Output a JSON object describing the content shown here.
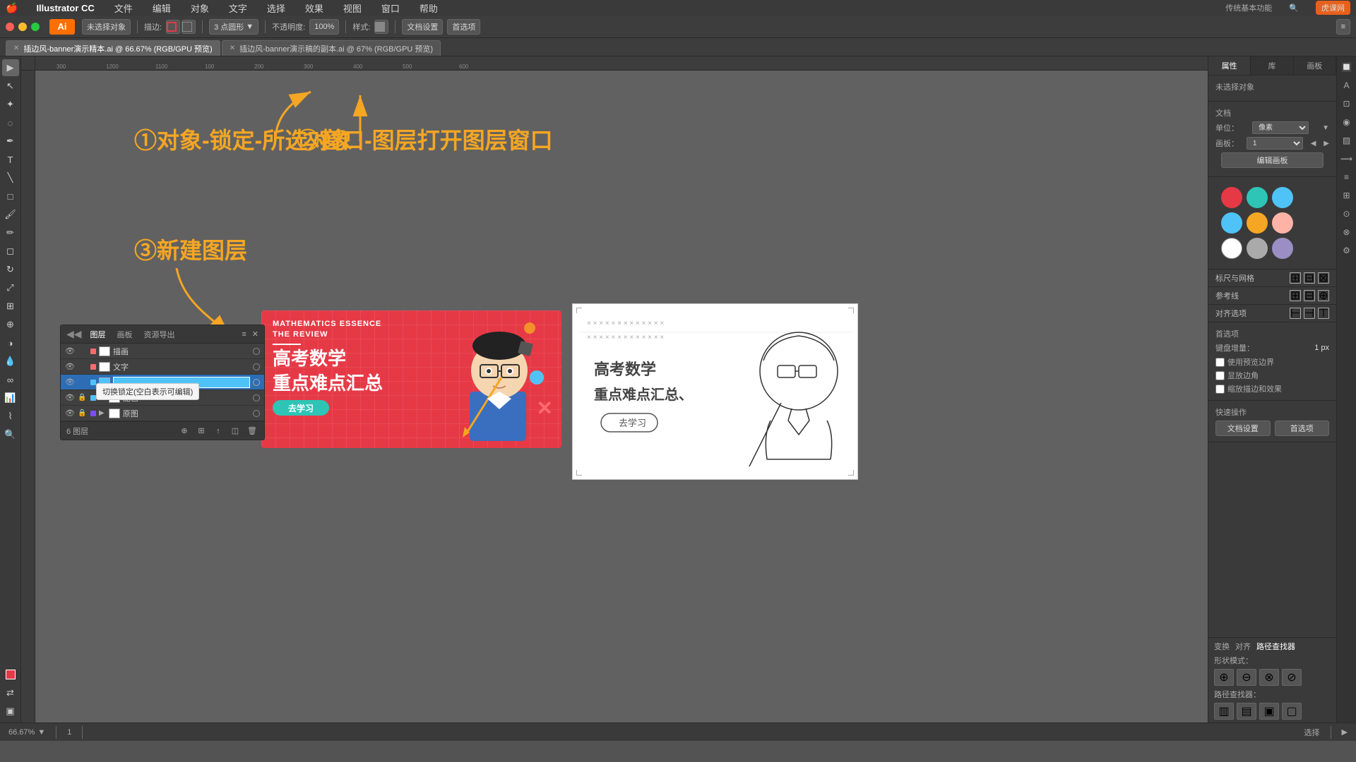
{
  "app": {
    "name": "Illustrator CC",
    "menu_items": [
      "文件",
      "编辑",
      "对象",
      "文字",
      "选择",
      "效果",
      "视图",
      "窗口",
      "帮助"
    ],
    "apple_menu": "🍎"
  },
  "toolbar": {
    "ai_label": "Ai",
    "tools": [
      "未选择对象"
    ],
    "desc_label": "描边:",
    "circle_label": "3 点圆形",
    "opacity_label": "不透明度:",
    "opacity_value": "100%",
    "style_label": "样式:",
    "doc_settings": "文档设置",
    "preferences": "首选项"
  },
  "tabs": [
    {
      "label": "插边风-banner演示精本.ai @ 66.67% (RGB/GPU 预览)",
      "active": true
    },
    {
      "label": "插边风-banner演示稿的副本.ai @ 67% (RGB/GPU 预览)",
      "active": false
    }
  ],
  "annotations": {
    "ann1": "①对象-锁定-所选对象",
    "ann2": "②窗口-图层打开图层窗口",
    "ann3": "③新建图层"
  },
  "math_banner": {
    "top_text_1": "MATHEMATICS ESSENCE",
    "top_text_2": "THE REVIEW",
    "main_text_1": "高考数学",
    "main_text_2": "重点难点汇总",
    "button_text": "去学习"
  },
  "sketch": {
    "text_1": "高考数学",
    "text_2": "重点难点汇总、",
    "button_text": "去学习"
  },
  "layers_panel": {
    "title": "图层",
    "tabs": [
      "图层",
      "画板",
      "资源导出"
    ],
    "layers": [
      {
        "name": "描画",
        "color": "#ff6b6b",
        "visible": true,
        "locked": false
      },
      {
        "name": "文字",
        "color": "#ff6b6b",
        "visible": true,
        "locked": false
      },
      {
        "name": "",
        "color": "#4fc3f7",
        "visible": true,
        "locked": false,
        "active": true,
        "editing": true
      },
      {
        "name": "配色",
        "color": "#4fc3f7",
        "visible": true,
        "locked": true,
        "has_sublayers": true
      },
      {
        "name": "原图",
        "color": "#7c4dff",
        "visible": true,
        "locked": true,
        "has_sublayers": true
      }
    ],
    "footer_text": "6 图层",
    "tooltip": "切换锁定(空白表示可编辑)"
  },
  "right_panel": {
    "tabs": [
      "属性",
      "库",
      "画板"
    ],
    "section_title": "未选择对象",
    "doc_section": "文档",
    "unit_label": "单位：",
    "unit_value": "像素",
    "artboard_label": "画板：",
    "artboard_value": "1",
    "edit_artboard_btn": "编辑画板",
    "align_section": "标尺与网格",
    "ref_section": "参考线",
    "align_to_section": "对齐选项",
    "snap_section": "首选项",
    "keyboard_nudge": "键盘增量：",
    "nudge_value": "1 px",
    "use_preview_bounds": "使用预览边界",
    "show_corner": "显放边角",
    "show_edge": "缩放描边和效果",
    "quick_actions": "快速操作",
    "doc_settings_btn": "文档设置",
    "preferences_btn": "首选项",
    "colors": [
      "#e63946",
      "#2ec4b6",
      "#4fc3f7",
      "#4fc3f7",
      "#f5a623",
      "#ffb3a7",
      "#ffffff",
      "#aaaaaa",
      "#9b8ec4"
    ]
  },
  "status_bar": {
    "zoom": "66.67%",
    "artboard": "1",
    "mode": "选择"
  },
  "bottom_panel": {
    "path_finder_label": "路径查找器",
    "shape_modes_label": "形状模式：",
    "pathfinder_label": "路径查找器："
  }
}
